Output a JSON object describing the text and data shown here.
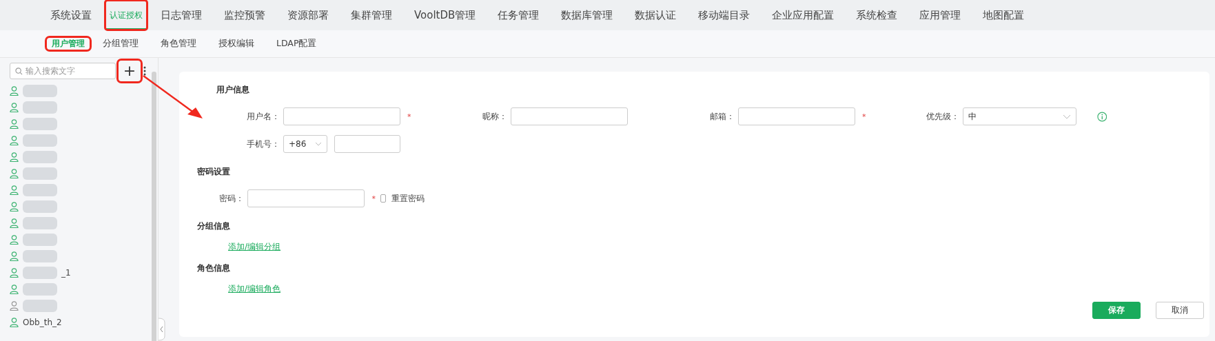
{
  "top_nav": [
    {
      "label": "系统设置",
      "selected": false,
      "highlighted": false
    },
    {
      "label": "认证授权",
      "selected": true,
      "highlighted": true
    },
    {
      "label": "日志管理",
      "selected": false,
      "highlighted": false
    },
    {
      "label": "监控预警",
      "selected": false,
      "highlighted": false
    },
    {
      "label": "资源部署",
      "selected": false,
      "highlighted": false
    },
    {
      "label": "集群管理",
      "selected": false,
      "highlighted": false
    },
    {
      "label": "VooltDB管理",
      "selected": false,
      "highlighted": false
    },
    {
      "label": "任务管理",
      "selected": false,
      "highlighted": false
    },
    {
      "label": "数据库管理",
      "selected": false,
      "highlighted": false
    },
    {
      "label": "数据认证",
      "selected": false,
      "highlighted": false
    },
    {
      "label": "移动端目录",
      "selected": false,
      "highlighted": false
    },
    {
      "label": "企业应用配置",
      "selected": false,
      "highlighted": false
    },
    {
      "label": "系统检查",
      "selected": false,
      "highlighted": false
    },
    {
      "label": "应用管理",
      "selected": false,
      "highlighted": false
    },
    {
      "label": "地图配置",
      "selected": false,
      "highlighted": false
    }
  ],
  "sub_nav": [
    {
      "label": "用户管理",
      "selected": true,
      "highlighted": true
    },
    {
      "label": "分组管理",
      "selected": false,
      "highlighted": false
    },
    {
      "label": "角色管理",
      "selected": false,
      "highlighted": false
    },
    {
      "label": "授权编辑",
      "selected": false,
      "highlighted": false
    },
    {
      "label": "LDAP配置",
      "selected": false,
      "highlighted": false
    }
  ],
  "sidebar": {
    "search": {
      "placeholder": "输入搜索文字"
    },
    "add_button": {
      "label": "+",
      "highlighted": true
    },
    "users": [
      {
        "blurred": true,
        "active": true
      },
      {
        "blurred": true,
        "active": true
      },
      {
        "blurred": true,
        "active": true
      },
      {
        "blurred": true,
        "active": true
      },
      {
        "blurred": true,
        "active": true
      },
      {
        "blurred": true,
        "active": true
      },
      {
        "blurred": true,
        "active": true
      },
      {
        "blurred": true,
        "active": true
      },
      {
        "blurred": true,
        "active": true
      },
      {
        "blurred": true,
        "active": true
      },
      {
        "blurred": true,
        "active": true
      },
      {
        "blurred": true,
        "active": true,
        "name": "_1"
      },
      {
        "blurred": true,
        "active": true
      },
      {
        "blurred": true,
        "active": false
      },
      {
        "blurred": false,
        "active": true,
        "name": "Obb_th_2"
      }
    ]
  },
  "form": {
    "sections": [
      {
        "title": "用户信息",
        "rows": [
          [
            {
              "kind": "text",
              "label": "用户名：",
              "required_mark": "*"
            },
            {
              "kind": "text",
              "label": "昵称："
            },
            {
              "kind": "text",
              "label": "邮箱：",
              "required_mark": "*"
            },
            {
              "kind": "select",
              "label": "优先级：",
              "value": "中",
              "info": true
            }
          ],
          [
            {
              "kind": "phone",
              "label": "手机号：",
              "code": "+86"
            }
          ]
        ]
      },
      {
        "title": "密码设置",
        "rows": [
          [
            {
              "kind": "password",
              "label": "密码：",
              "required_mark": "*",
              "checkbox": {
                "label": "重置密码",
                "checked": false
              }
            }
          ]
        ]
      },
      {
        "title": "分组信息",
        "link": "添加/编辑分组"
      },
      {
        "title": "角色信息",
        "link": "添加/编辑角色"
      }
    ]
  },
  "buttons": [
    {
      "label": "保存",
      "kind": "primary"
    },
    {
      "label": "取消",
      "kind": "secondary"
    }
  ]
}
